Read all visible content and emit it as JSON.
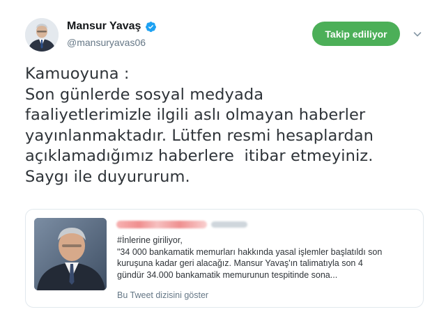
{
  "author": {
    "display_name": "Mansur Yavaş",
    "handle": "@mansuryavas06",
    "verified": true,
    "avatar": "profile-photo"
  },
  "follow_button": {
    "label": "Takip ediliyor",
    "color": "#4caf58"
  },
  "menu_icon": "chevron-down-icon",
  "tweet": {
    "lines": [
      "Kamuoyuna :",
      "Son günlerde sosyal medyada",
      "faaliyetlerimizle ilgili aslı olmayan haberler",
      "yayınlanmaktadır. Lütfen resmi hesaplardan",
      "açıklamadığımız haberlere  itibar etmeyiniz.",
      "Saygı ile duyururum."
    ]
  },
  "quoted_tweet": {
    "image": "quoted-photo",
    "lines": [
      "#İnlerine giriliyor,",
      "\"34 000 bankamatik memurları hakkında yasal işlemler başlatıldı son",
      "kuruşuna kadar geri alacağız. Mansur Yavaş'ın talimatıyla son 4",
      "gündür  34.000 bankamatik memurunun tespitinde sona..."
    ],
    "show_thread_label": "Bu Tweet dizisini göster"
  },
  "colors": {
    "verified_badge": "#1da1f2",
    "secondary_text": "#657786",
    "card_border": "#e1e8ed"
  }
}
